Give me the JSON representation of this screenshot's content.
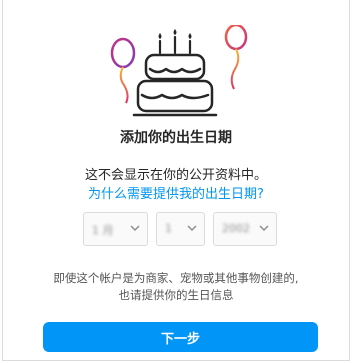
{
  "dialog": {
    "title": "添加你的出生日期",
    "subtitle": "这不会显示在你的公开资料中。",
    "why_link": "为什么需要提供我的出生日期?",
    "birthday": {
      "month_value": "1 月",
      "day_value": "1",
      "year_value": "2002"
    },
    "note_line1": "即使这个帐户是为商家、宠物或其他事物创建的,",
    "note_line2": "也请提供你的生日信息",
    "next_label": "下一步"
  },
  "icons": {
    "illustration": "birthday-cake-with-balloons-icon",
    "select_arrow": "chevron-down-icon"
  },
  "colors": {
    "accent": "#0095f6",
    "balloon_left": "#8e44ad",
    "balloon_right": "#e1306c",
    "balloon_string_gradient": [
      "#f7b733",
      "#e1306c"
    ]
  }
}
